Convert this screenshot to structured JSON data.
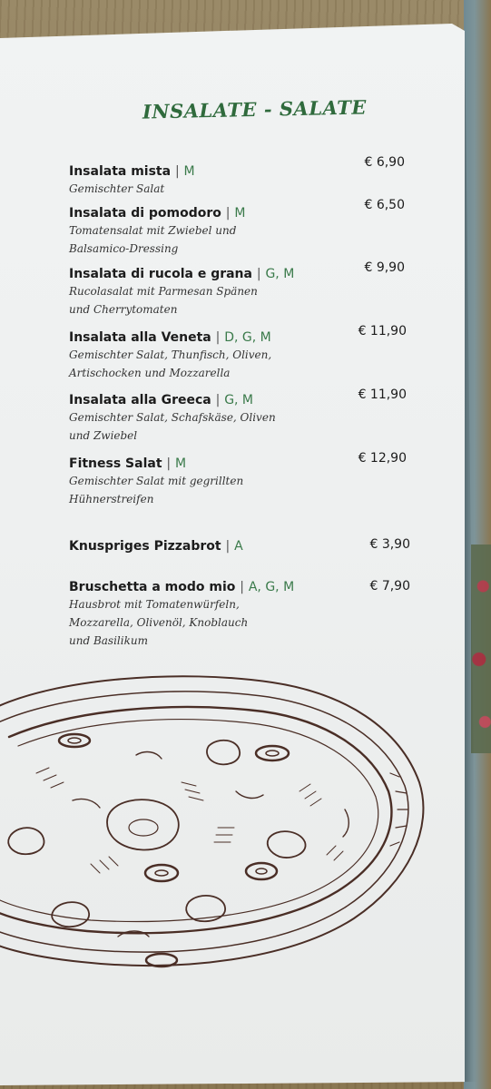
{
  "section_title": "INSALATE - SALATE",
  "items": [
    {
      "name": "Insalata mista",
      "allergens": "M",
      "description_lines": [
        "Gemischter Salat"
      ],
      "price": "€ 6,90"
    },
    {
      "name": "Insalata di pomodoro",
      "allergens": "M",
      "description_lines": [
        "Tomatensalat mit Zwiebel und",
        "Balsamico-Dressing"
      ],
      "price": "€ 6,50"
    },
    {
      "name": "Insalata di rucola e grana",
      "allergens": "G, M",
      "description_lines": [
        "Rucolasalat mit Parmesan Spänen",
        "und Cherrytomaten"
      ],
      "price": "€ 9,90"
    },
    {
      "name": "Insalata alla Veneta",
      "allergens": "D, G, M",
      "description_lines": [
        "Gemischter Salat, Thunfisch, Oliven,",
        "Artischocken und Mozzarella"
      ],
      "price": "€ 11,90"
    },
    {
      "name": "Insalata alla Greeca",
      "allergens": "G, M",
      "description_lines": [
        "Gemischter Salat, Schafskäse, Oliven",
        "und Zwiebel"
      ],
      "price": "€ 11,90"
    },
    {
      "name": "Fitness Salat",
      "allergens": "M",
      "description_lines": [
        "Gemischter Salat mit gegrillten",
        "Hühnerstreifen"
      ],
      "price": "€ 12,90"
    },
    {
      "name": "Knuspriges Pizzabrot",
      "allergens": "A",
      "description_lines": [],
      "price": "€ 3,90"
    },
    {
      "name": "Bruschetta a modo mio",
      "allergens": "A, G, M",
      "description_lines": [
        "Hausbrot mit Tomatenwürfeln,",
        "Mozzarella, Olivenöl, Knoblauch",
        "und Basilikum"
      ],
      "price": "€ 7,90"
    }
  ],
  "separator": "|",
  "illustration": "pizza-sketch",
  "colors": {
    "title_green": "#2f6a3c",
    "allergen_green": "#3a7a4a",
    "ink_brown": "#4a2e26",
    "paper": "#eef0f0"
  }
}
